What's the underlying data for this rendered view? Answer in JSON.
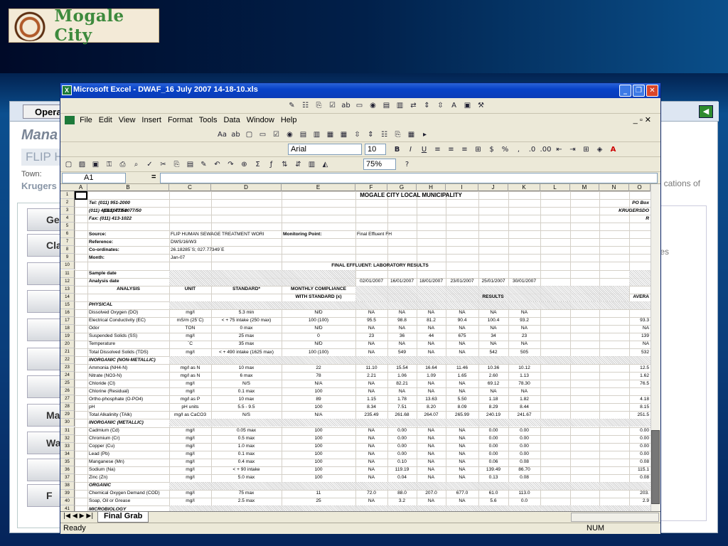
{
  "logo": {
    "text": "Mogale City"
  },
  "web": {
    "operations_tab": "Opera",
    "heading": "Mana",
    "flip_label": "FLIP H",
    "town_label": "Town:",
    "town_value": "Krugers",
    "right_text_1": "cations of",
    "right_text_2": "les",
    "left_buttons": [
      "Ge",
      "Clas",
      "",
      "",
      "",
      "",
      "",
      "Man",
      "Wa",
      "",
      "F",
      ""
    ]
  },
  "window": {
    "title": "Microsoft Excel - DWAF_16 July 2007  14-18-10.xls",
    "buttons": {
      "minimize": "_",
      "restore": "❐",
      "close": "✕"
    }
  },
  "menu": [
    "File",
    "Edit",
    "View",
    "Insert",
    "Format",
    "Tools",
    "Data",
    "Window",
    "Help"
  ],
  "format_bar": {
    "font": "Arial",
    "size": "10",
    "zoom": "75%"
  },
  "formula_bar": {
    "name_box": "A1",
    "equals": "="
  },
  "columns": [
    "A",
    "B",
    "C",
    "D",
    "E",
    "F",
    "G",
    "H",
    "I",
    "J",
    "K",
    "L",
    "M",
    "N",
    "O"
  ],
  "row_numbers": [
    "1",
    "2",
    "3",
    "4",
    "5",
    "6",
    "7",
    "8",
    "9",
    "10",
    "11",
    "12",
    "13",
    "14",
    "15",
    "16",
    "17",
    "18",
    "19",
    "20",
    "21",
    "22",
    "23",
    "24",
    "25",
    "26",
    "27",
    "28",
    "29",
    "30",
    "31",
    "32",
    "33",
    "34",
    "35",
    "36",
    "37",
    "38",
    "39",
    "40",
    "41"
  ],
  "sheet": {
    "title": "MOGALE CITY LOCAL MUNICIPALITY",
    "tel": "Tel: (011) 951-2000",
    "fax1": "(011) 413-1077/50",
    "fax2": "Fax: (011) 413-1022",
    "po_box": "PO Box",
    "krugersdorp": "KRUGERSDO",
    "r": "R",
    "source_label": "Source:",
    "source_value": "FLIP HUMAN SEWAGE TREATMENT WORI",
    "monitoring_label": "Monitoring Point:",
    "monitoring_value": "Final Effluent FH",
    "reference_label": "Reference:",
    "reference_value": "DWS/16/W3",
    "coords_label": "Co-ordinates:",
    "coords_value": "26.18285`S; 027.77349`E",
    "month_label": "Month:",
    "month_value": "Jan-07",
    "section_title": "FINAL EFFLUENT: LABORATORY RESULTS",
    "sample_date": "Sample date",
    "analysis_date": "Analysis date",
    "dates": [
      "02/01/2007",
      "16/01/2007",
      "18/01/2007",
      "23/01/2007",
      "25/01/2007",
      "30/01/2007"
    ],
    "hdr_analysis": "ANALYSIS",
    "hdr_unit": "UNIT",
    "hdr_standard": "STANDARD*",
    "hdr_monthly1": "MONTHLY COMPLIANCE",
    "hdr_monthly2": "WITH STANDARD (x)",
    "hdr_results": "RESULTS",
    "hdr_avg": "AVERA",
    "rows": [
      {
        "r": 15,
        "sec": "PHYSICAL"
      },
      {
        "r": 16,
        "a": "Dissolved Oxygen (DO)",
        "u": "mg/l",
        "s": "5.3 min",
        "m": "N/D",
        "v": [
          "NA",
          "NA",
          "NA",
          "NA",
          "NA",
          "NA"
        ],
        "avg": ""
      },
      {
        "r": 17,
        "a": "Electrical Conductivity (EC)",
        "u": "mS/m (25`C)",
        "s": "< + 75 intake (250 max)",
        "m": "100 (100)",
        "v": [
          "95.5",
          "98.8",
          "81.2",
          "90.4",
          "100.4",
          "93.2"
        ],
        "avg": "93.3"
      },
      {
        "r": 18,
        "a": "Odor",
        "u": "TON",
        "s": "0 max",
        "m": "N/D",
        "v": [
          "NA",
          "NA",
          "NA",
          "NA",
          "NA",
          "NA"
        ],
        "avg": "NA"
      },
      {
        "r": 19,
        "a": "Suspended Solids (SS)",
        "u": "mg/l",
        "s": "25 max",
        "m": "0",
        "v": [
          "23",
          "36",
          "44",
          "675",
          "34",
          "23"
        ],
        "avg": "139"
      },
      {
        "r": 20,
        "a": "Temperature",
        "u": "`C",
        "s": "35 max",
        "m": "N/D",
        "v": [
          "NA",
          "NA",
          "NA",
          "NA",
          "NA",
          "NA"
        ],
        "avg": "NA"
      },
      {
        "r": 21,
        "a": "Total Dissolved Solids (TDS)",
        "u": "mg/l",
        "s": "< + 490 intake (1625 max)",
        "m": "100 (100)",
        "v": [
          "NA",
          "549",
          "NA",
          "NA",
          "542",
          "505"
        ],
        "avg": "532"
      },
      {
        "r": 22,
        "sec": "INORGANIC (NON-METALLIC)"
      },
      {
        "r": 23,
        "a": "Ammonia (NH4-N)",
        "u": "mg/l as N",
        "s": "10 max",
        "m": "22",
        "v": [
          "11.10",
          "15.54",
          "16.64",
          "11.46",
          "10.36",
          "10.12"
        ],
        "avg": "12.5"
      },
      {
        "r": 24,
        "a": "Nitrate (NO3-N)",
        "u": "mg/l as N",
        "s": "6 max",
        "m": "78",
        "v": [
          "2.21",
          "1.06",
          "1.09",
          "1.65",
          "2.60",
          "1.13"
        ],
        "avg": "1.62"
      },
      {
        "r": 25,
        "a": "Chloride (Cl)",
        "u": "mg/l",
        "s": "N/S",
        "m": "N/A",
        "v": [
          "NA",
          "82.21",
          "NA",
          "NA",
          "69.12",
          "78.30"
        ],
        "avg": "76.5"
      },
      {
        "r": 26,
        "a": "Chlorine (Residual)",
        "u": "mg/l",
        "s": "0.1 max",
        "m": "100",
        "v": [
          "NA",
          "NA",
          "NA",
          "NA",
          "NA",
          "NA"
        ],
        "avg": ""
      },
      {
        "r": 27,
        "a": "Ortho-phosphate (O-PO4)",
        "u": "mg/l as P",
        "s": "10 max",
        "m": "89",
        "v": [
          "1.15",
          "1.78",
          "13.63",
          "5.50",
          "1.18",
          "1.82"
        ],
        "avg": "4.18"
      },
      {
        "r": 28,
        "a": "pH",
        "u": "pH units",
        "s": "5.5 - 9.5",
        "m": "100",
        "v": [
          "8.34",
          "7.51",
          "8.20",
          "8.09",
          "8.29",
          "8.44"
        ],
        "avg": "8.15"
      },
      {
        "r": 29,
        "a": "Total Alkalinity (TAlk)",
        "u": "mg/l as CaCO3",
        "s": "N/S",
        "m": "N/A",
        "v": [
          "235.49",
          "261.68",
          "264.07",
          "265.99",
          "240.19",
          "241.67"
        ],
        "avg": "251.5"
      },
      {
        "r": 30,
        "sec": "INORGANIC (METALLIC)"
      },
      {
        "r": 31,
        "a": "Cadmium (Cd)",
        "u": "mg/l",
        "s": "0.05 max",
        "m": "100",
        "v": [
          "NA",
          "0.00",
          "NA",
          "NA",
          "0.00",
          "0.00"
        ],
        "avg": "0.00"
      },
      {
        "r": 32,
        "a": "Chromium (Cr)",
        "u": "mg/l",
        "s": "0.5 max",
        "m": "100",
        "v": [
          "NA",
          "0.00",
          "NA",
          "NA",
          "0.00",
          "0.00"
        ],
        "avg": "0.00"
      },
      {
        "r": 33,
        "a": "Copper (Cu)",
        "u": "mg/l",
        "s": "1.0 max",
        "m": "100",
        "v": [
          "NA",
          "0.00",
          "NA",
          "NA",
          "0.00",
          "0.00"
        ],
        "avg": "0.00"
      },
      {
        "r": 34,
        "a": "Lead (Pb)",
        "u": "mg/l",
        "s": "0.1 max",
        "m": "100",
        "v": [
          "NA",
          "0.00",
          "NA",
          "NA",
          "0.00",
          "0.00"
        ],
        "avg": "0.00"
      },
      {
        "r": 35,
        "a": "Manganese (Mn)",
        "u": "mg/l",
        "s": "0.4 max",
        "m": "100",
        "v": [
          "NA",
          "0.10",
          "NA",
          "NA",
          "0.06",
          "0.08"
        ],
        "avg": "0.08"
      },
      {
        "r": 36,
        "a": "Sodium (Na)",
        "u": "mg/l",
        "s": "< + 90 intake",
        "m": "100",
        "v": [
          "NA",
          "119.19",
          "NA",
          "NA",
          "139.49",
          "86.70"
        ],
        "avg": "115.1"
      },
      {
        "r": 37,
        "a": "Zinc (Zn)",
        "u": "mg/l",
        "s": "5.0 max",
        "m": "100",
        "v": [
          "NA",
          "0.04",
          "NA",
          "NA",
          "0.13",
          "0.08"
        ],
        "avg": "0.08"
      },
      {
        "r": 38,
        "sec": "ORGANIC"
      },
      {
        "r": 39,
        "a": "Chemical Oxygen Demand (COD)",
        "u": "mg/l",
        "s": "75 max",
        "m": "11",
        "v": [
          "72.0",
          "88.0",
          "207.0",
          "677.0",
          "61.0",
          "113.0"
        ],
        "avg": "203."
      },
      {
        "r": 40,
        "a": "Soap, Oil or Grease",
        "u": "mg/l",
        "s": "2.5 max",
        "m": "25",
        "v": [
          "NA",
          "3.2",
          "NA",
          "NA",
          "5.6",
          "0.0"
        ],
        "avg": "2.9"
      },
      {
        "r": 41,
        "sec": "MICROBIOLOGY"
      }
    ]
  },
  "sheet_tab": "Final Grab",
  "status": {
    "ready": "Ready",
    "num": "NUM"
  }
}
